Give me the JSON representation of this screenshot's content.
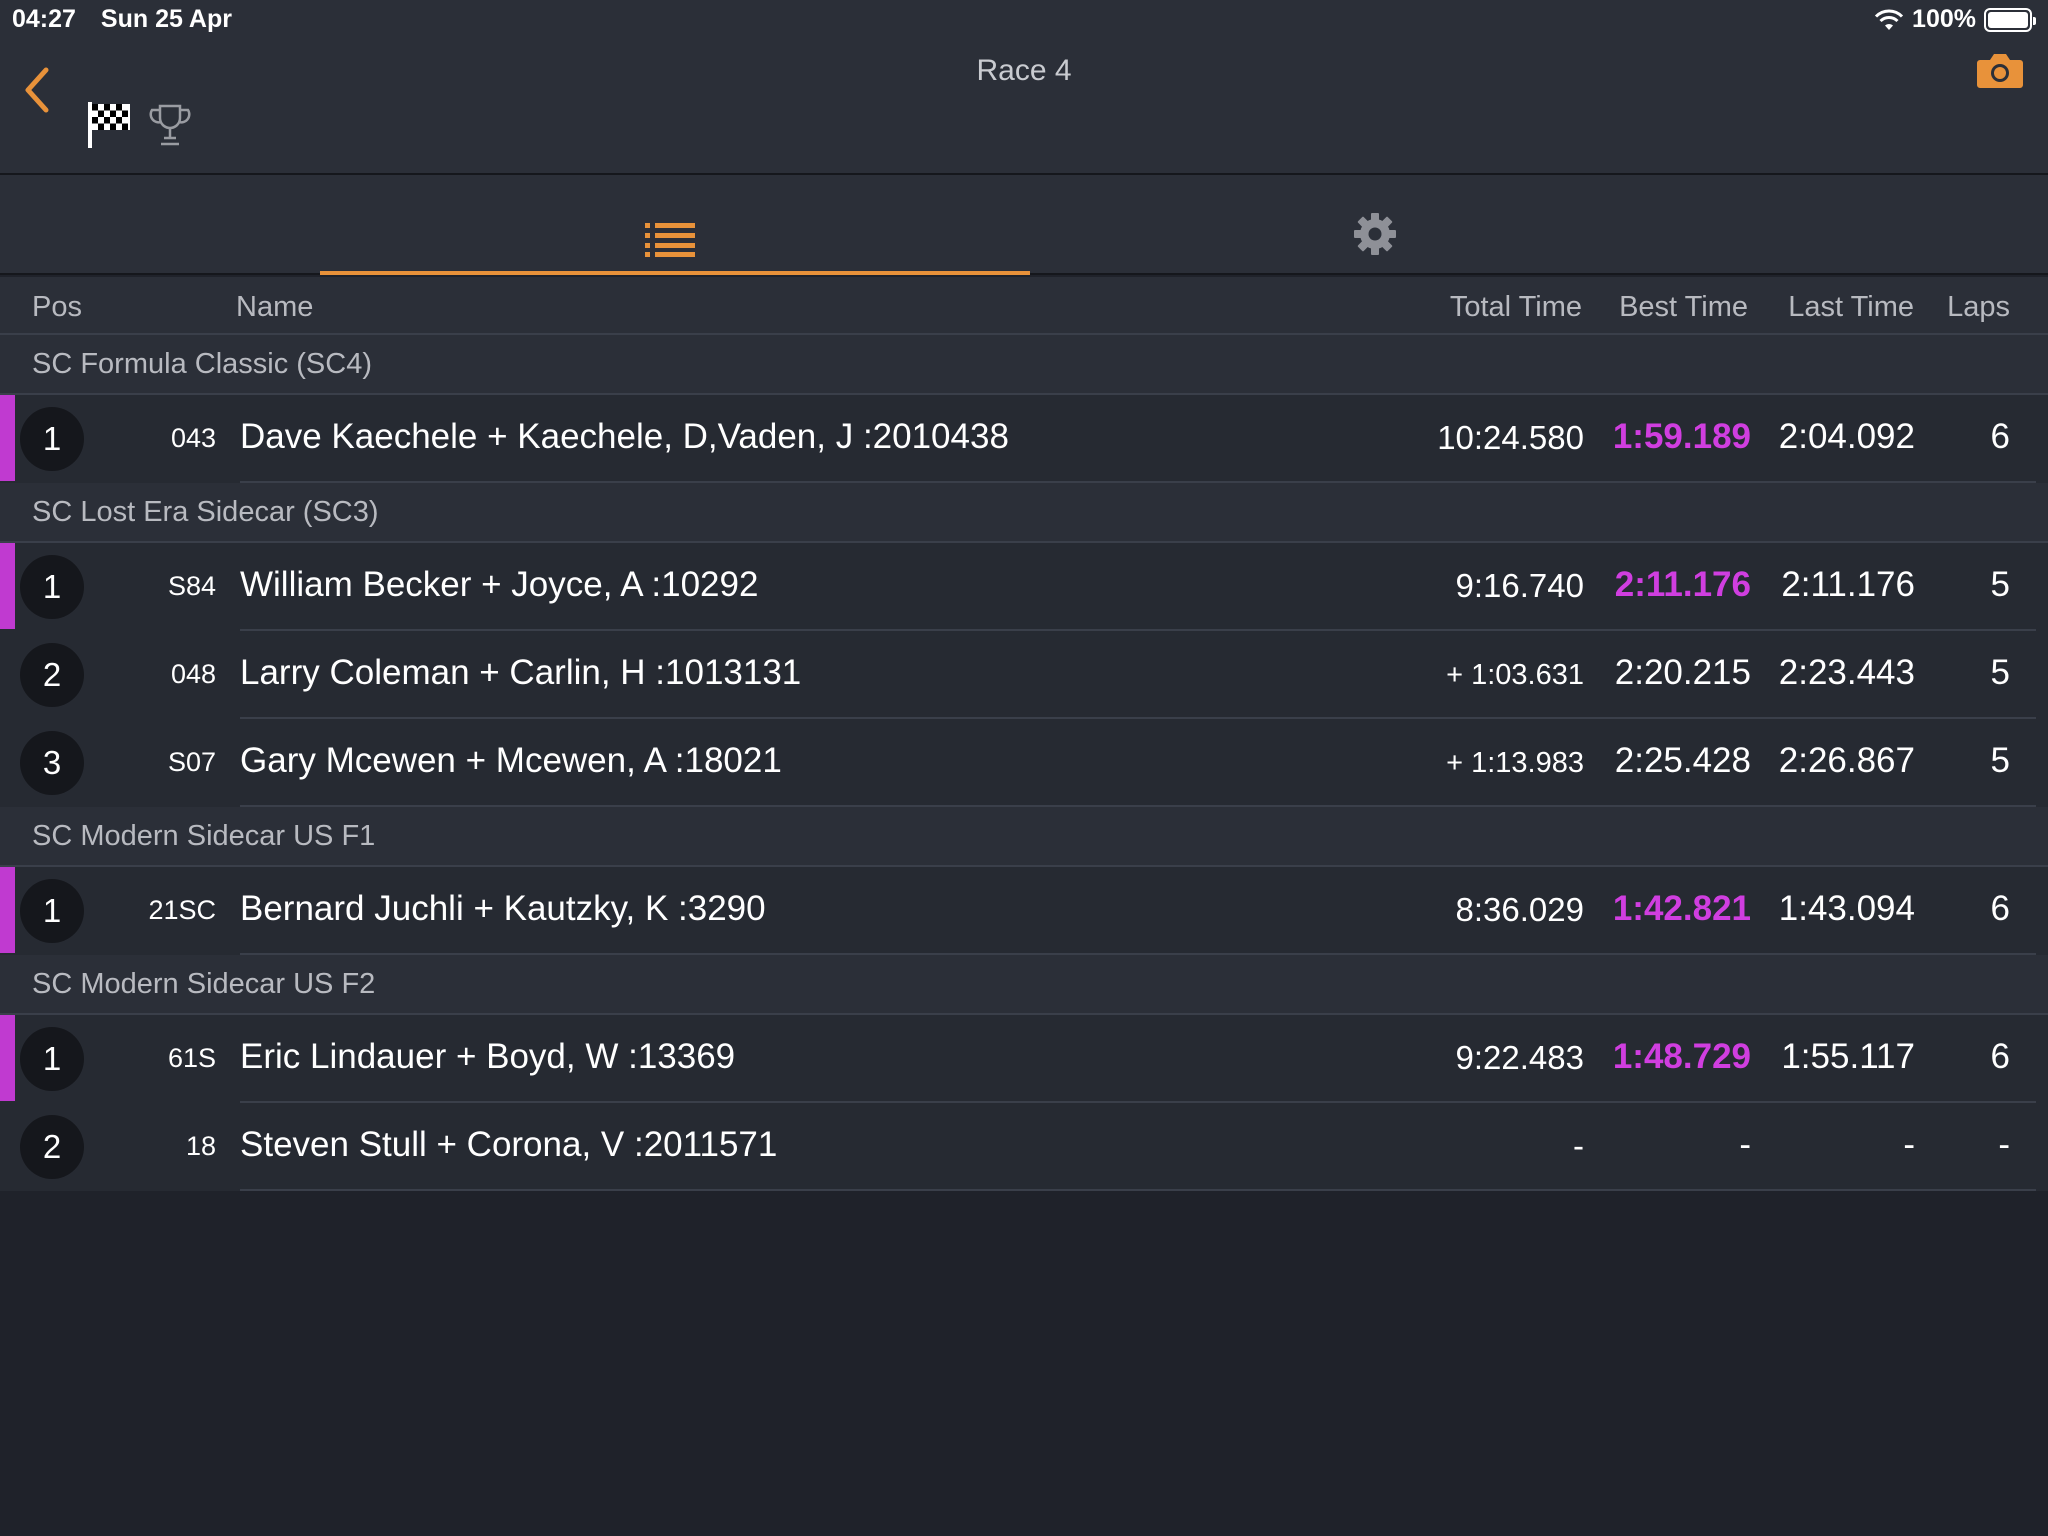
{
  "status_bar": {
    "time": "04:27",
    "date": "Sun 25 Apr",
    "battery": "100%"
  },
  "nav": {
    "title": "Race 4"
  },
  "columns": {
    "pos": "Pos",
    "name": "Name",
    "total_time": "Total Time",
    "best_time": "Best Time",
    "last_time": "Last Time",
    "laps": "Laps"
  },
  "colors": {
    "accent": "#e8923a",
    "purple": "#d03ee0",
    "background": "#1f222a"
  },
  "groups": [
    {
      "title": "SC Formula Classic (SC4)",
      "rows": [
        {
          "pos": "1",
          "num": "043",
          "name": "Dave Kaechele + Kaechele, D,Vaden, J :2010438",
          "total": "10:24.580",
          "best": "1:59.189",
          "last": "2:04.092",
          "laps": "6"
        }
      ]
    },
    {
      "title": "SC Lost Era Sidecar (SC3)",
      "rows": [
        {
          "pos": "1",
          "num": "S84",
          "name": "William Becker + Joyce, A :10292",
          "total": "9:16.740",
          "best": "2:11.176",
          "last": "2:11.176",
          "laps": "5"
        },
        {
          "pos": "2",
          "num": "048",
          "name": "Larry Coleman + Carlin, H :1013131",
          "total": "+ 1:03.631",
          "best": "2:20.215",
          "last": "2:23.443",
          "laps": "5"
        },
        {
          "pos": "3",
          "num": "S07",
          "name": "Gary Mcewen + Mcewen, A :18021",
          "total": "+ 1:13.983",
          "best": "2:25.428",
          "last": "2:26.867",
          "laps": "5"
        }
      ]
    },
    {
      "title": "SC Modern Sidecar US F1",
      "rows": [
        {
          "pos": "1",
          "num": "21SC",
          "name": "Bernard Juchli + Kautzky, K :3290",
          "total": "8:36.029",
          "best": "1:42.821",
          "last": "1:43.094",
          "laps": "6"
        }
      ]
    },
    {
      "title": "SC Modern Sidecar US F2",
      "rows": [
        {
          "pos": "1",
          "num": "61S",
          "name": "Eric Lindauer + Boyd, W :13369",
          "total": "9:22.483",
          "best": "1:48.729",
          "last": "1:55.117",
          "laps": "6"
        },
        {
          "pos": "2",
          "num": "18",
          "name": "Steven Stull + Corona, V :2011571",
          "total": "-",
          "best": "-",
          "last": "-",
          "laps": "-"
        }
      ]
    }
  ]
}
